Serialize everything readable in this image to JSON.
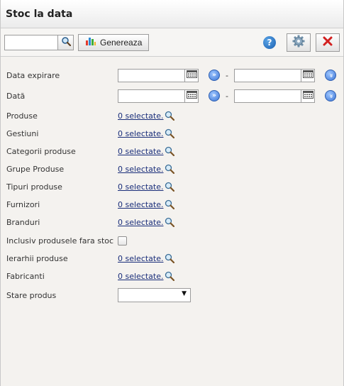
{
  "window": {
    "title": "Stoc la data"
  },
  "toolbar": {
    "search_value": "",
    "generate_label": "Genereaza",
    "help_symbol": "?"
  },
  "form": {
    "data_expirare_label": "Data expirare",
    "data_label": "Dată",
    "range_separator": "-",
    "selectors": [
      {
        "label": "Produse",
        "link": "0 selectate."
      },
      {
        "label": "Gestiuni",
        "link": "0 selectate."
      },
      {
        "label": "Categorii produse",
        "link": "0 selectate."
      },
      {
        "label": "Grupe Produse",
        "link": "0 selectate."
      },
      {
        "label": "Tipuri produse",
        "link": "0 selectate."
      },
      {
        "label": "Furnizori",
        "link": "0 selectate."
      },
      {
        "label": "Branduri",
        "link": "0 selectate."
      }
    ],
    "inclusiv_label": "Inclusiv produsele fara stoc",
    "selectors2": [
      {
        "label": "Ierarhii produse",
        "link": "0 selectate."
      },
      {
        "label": "Fabricanti",
        "link": "0 selectate."
      }
    ],
    "stare_label": "Stare produs",
    "stare_value": ""
  },
  "icons": [
    "search-icon",
    "chart-icon",
    "help-icon",
    "gear-icon",
    "close-icon",
    "calendar-icon",
    "double-right-icon",
    "double-down-icon",
    "magnifier-icon"
  ],
  "colors": {
    "link": "#1a2e7a",
    "close_red": "#d21f1f",
    "accent_blue": "#3d76d6"
  }
}
